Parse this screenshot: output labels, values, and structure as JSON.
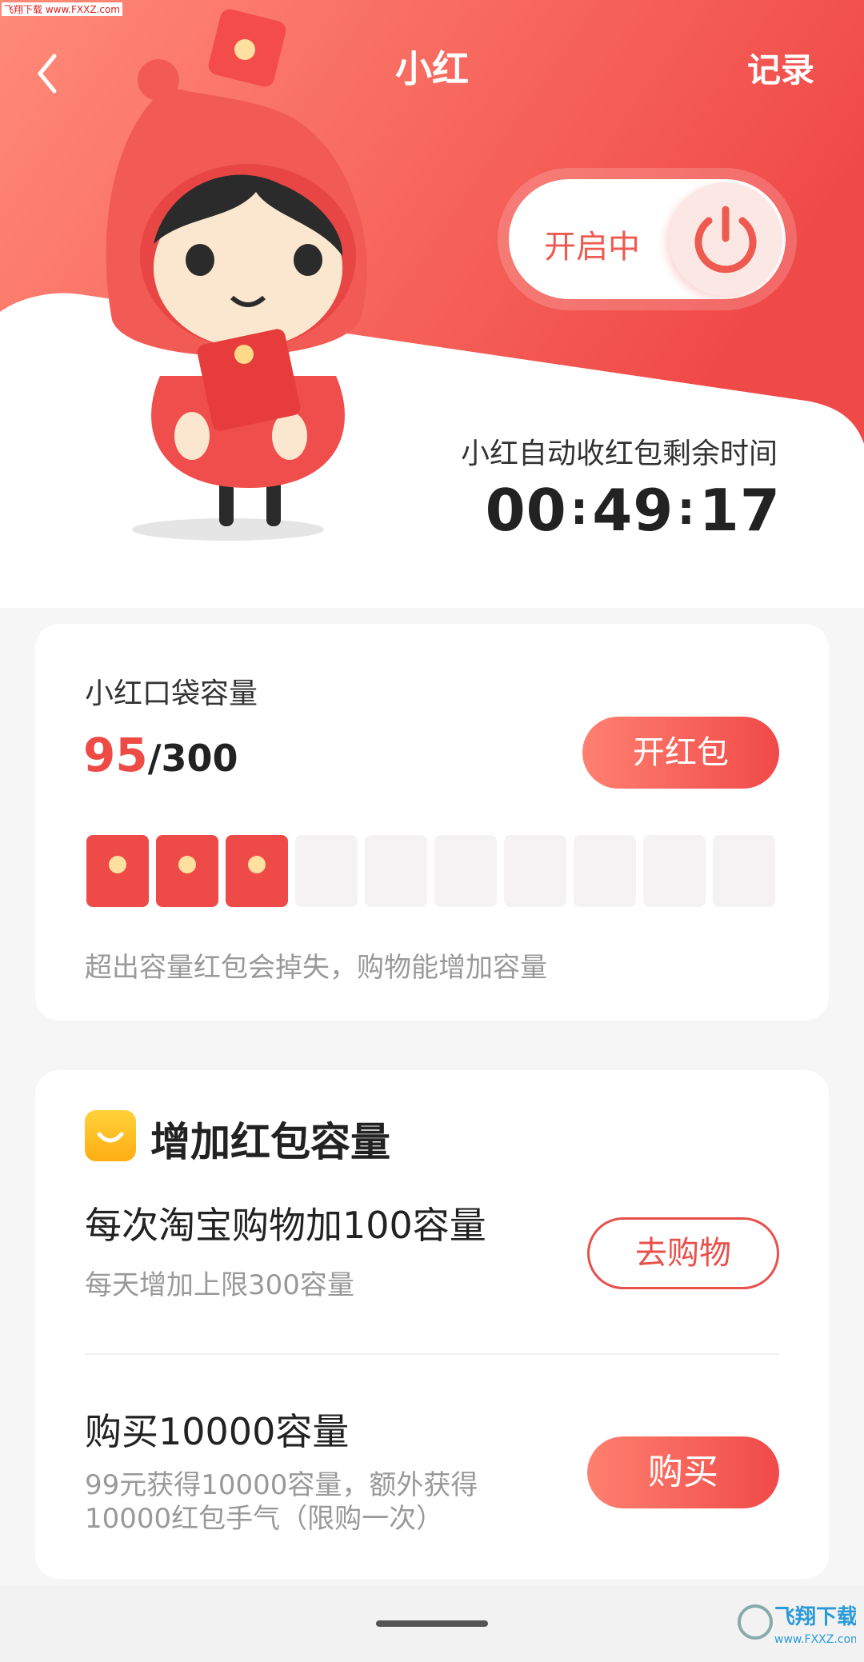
{
  "watermark": "飞翔下载 www.FXXZ.com",
  "header": {
    "title": "小红",
    "record_label": "记录"
  },
  "toggle": {
    "label": "开启中",
    "icon": "power-icon",
    "on": true
  },
  "timer": {
    "label": "小红自动收红包剩余时间",
    "hours": "00",
    "minutes": "49",
    "seconds": "17",
    "separator": ":"
  },
  "capacity": {
    "label": "小红口袋容量",
    "current": "95",
    "total": "/300",
    "open_button": "开红包",
    "slots_filled": 3,
    "slots_total": 10,
    "tip": "超出容量红包会掉失，购物能增加容量"
  },
  "increase": {
    "title": "增加红包容量",
    "items": [
      {
        "title": "每次淘宝购物加100容量",
        "subtitle": "每天增加上限300容量",
        "button": "去购物"
      },
      {
        "title": "购买10000容量",
        "subtitle_line1": "99元获得10000容量，额外获得",
        "subtitle_line2": "10000红包手气（限购一次）",
        "button": "购买"
      }
    ]
  },
  "footer_watermark": {
    "text": "飞翔下载",
    "url": "www.FXXZ.com"
  },
  "colors": {
    "accent": "#ee4a46",
    "hero_start": "#ff8a78",
    "hero_end": "#f04a48"
  }
}
